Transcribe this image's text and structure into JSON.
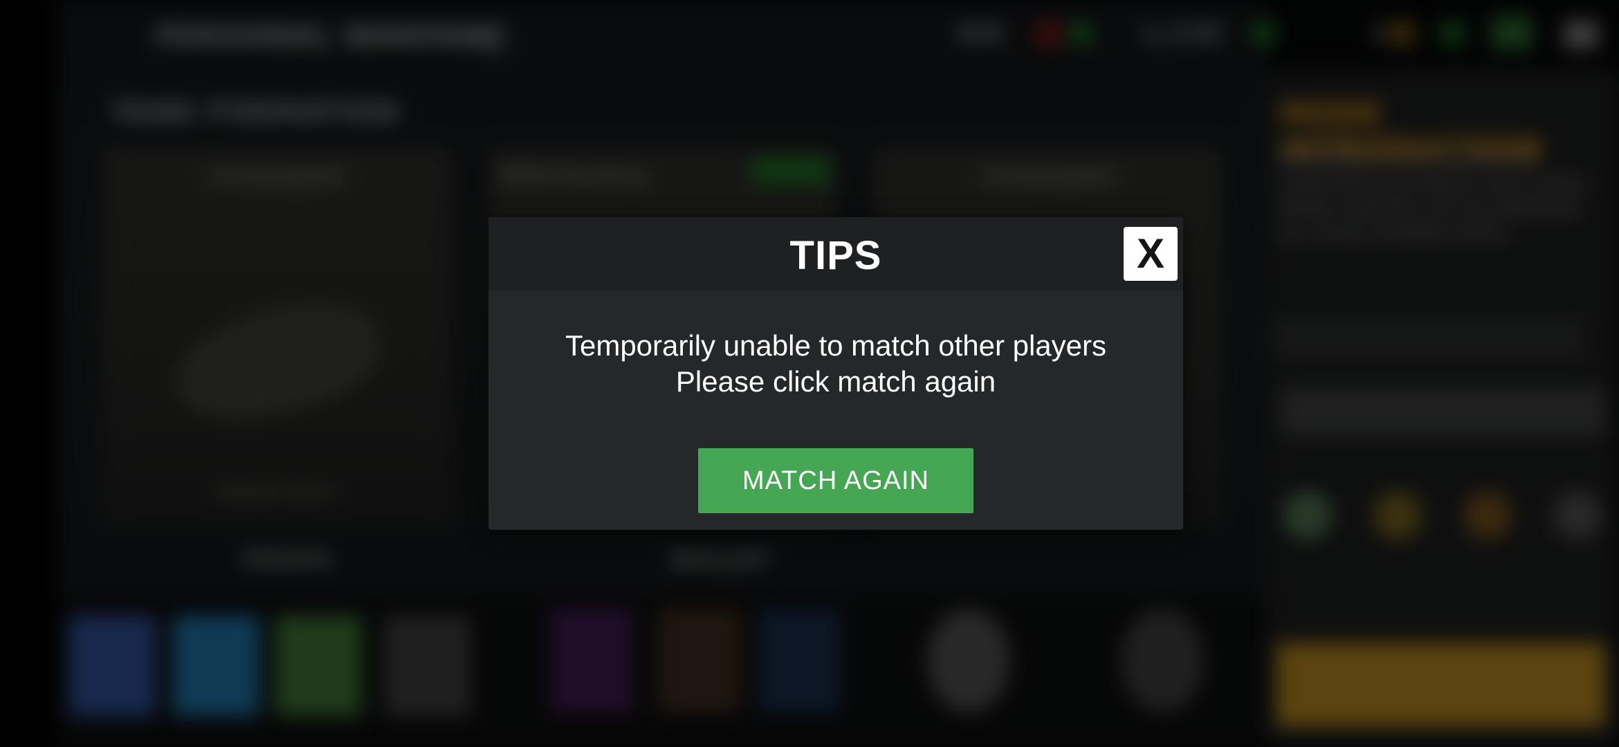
{
  "background": {
    "mode_title": "PERSONAL WARFARE",
    "resource_1": "0/6",
    "resource_2": "1,110",
    "resource_3": "1",
    "section_title": "TANK FORMATION",
    "slot_left_label": "Unequipped",
    "slot_middle_label": "MSN Pending",
    "slot_right_label": "Unequipped",
    "slot_left_footer": "Default paint",
    "tab_left": "PROPS",
    "tab_right": "BULLET",
    "mode_intro_title": "MODE INTRODUCTION",
    "mode_intro_text": "Multiplayer solo randomly matched and attack each other. Mode rewards can be obtained by using multiple tanks.",
    "battle_label": "BATTLE",
    "colors": {
      "accent_gold": "#c98a1a",
      "green": "#1c6d22"
    }
  },
  "dialog": {
    "title": "TIPS",
    "close_label": "X",
    "message_line1": "Temporarily unable to match other players",
    "message_line2": "Please click match again",
    "action_label": "MATCH AGAIN",
    "colors": {
      "header": "#1e2021",
      "body": "#252829",
      "button": "#45a654"
    }
  }
}
